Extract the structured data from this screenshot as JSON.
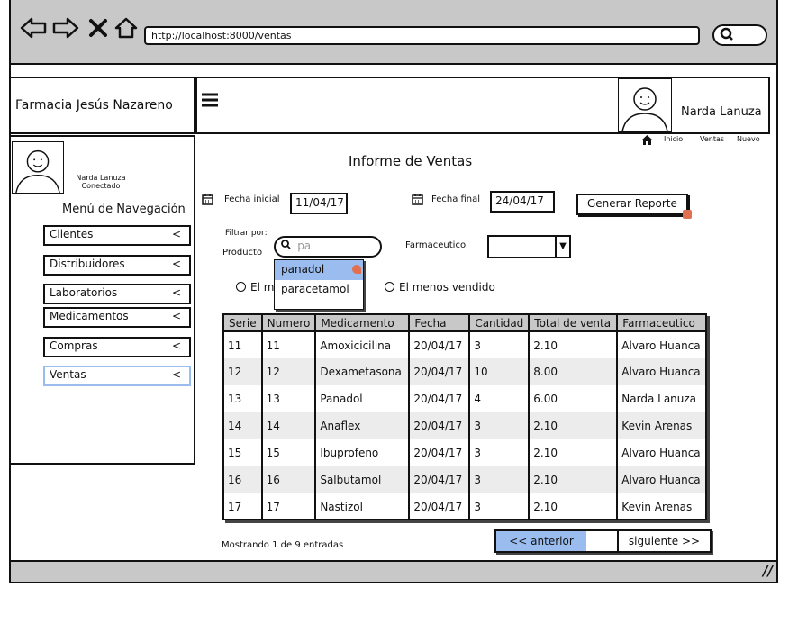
{
  "browser": {
    "back_icon": "arrow-left-icon",
    "forward_icon": "arrow-right-icon",
    "close_icon": "x-icon",
    "home_icon": "home-outline-icon",
    "url": "http://localhost:8000/ventas",
    "search_icon": "search-icon"
  },
  "header": {
    "brand": "Farmacia Jesús Nazareno",
    "menu_icon": "hamburger-icon",
    "user_name": "Narda Lanuza",
    "breadcrumb": [
      "Inicio",
      "Ventas",
      "Nuevo"
    ]
  },
  "sidebar": {
    "user_name": "Narda Lanuza",
    "status": "Conectado",
    "menu_title": "Menú de Navegación",
    "items": [
      {
        "label": "Clientes",
        "chevron": "<"
      },
      {
        "label": "Distribuidores",
        "chevron": "<"
      },
      {
        "label": "Laboratorios",
        "chevron": "<"
      },
      {
        "label": "Medicamentos",
        "chevron": "<"
      },
      {
        "label": "Compras",
        "chevron": "<"
      },
      {
        "label": "Ventas",
        "chevron": "<"
      }
    ]
  },
  "main": {
    "title": "Informe de Ventas",
    "fecha_inicial_label": "Fecha inicial",
    "fecha_inicial": "11/04/17",
    "fecha_final_label": "Fecha final",
    "fecha_final": "24/04/17",
    "generate_button": "Generar Reporte",
    "filter_label": "Filtrar por:",
    "producto_label": "Producto",
    "producto_value": "pa",
    "farmaceutico_label": "Farmaceutico",
    "farmaceutico_value": "",
    "dropdown_options": [
      "panadol",
      "paracetamol"
    ],
    "radio_most_prefix": "El m",
    "radio_least": "El menos vendido"
  },
  "table": {
    "columns": [
      "Serie",
      "Numero",
      "Medicamento",
      "Fecha",
      "Cantidad",
      "Total de venta",
      "Farmaceutico"
    ],
    "rows": [
      [
        "11",
        "11",
        "Amoxicicilina",
        "20/04/17",
        "3",
        "2.10",
        "Alvaro Huanca"
      ],
      [
        "12",
        "12",
        "Dexametasona",
        "20/04/17",
        "10",
        "8.00",
        "Alvaro Huanca"
      ],
      [
        "13",
        "13",
        "Panadol",
        "20/04/17",
        "4",
        "6.00",
        "Narda Lanuza"
      ],
      [
        "14",
        "14",
        "Anaflex",
        "20/04/17",
        "3",
        "2.10",
        "Kevin Arenas"
      ],
      [
        "15",
        "15",
        "Ibuprofeno",
        "20/04/17",
        "3",
        "2.10",
        "Alvaro Huanca"
      ],
      [
        "16",
        "16",
        "Salbutamol",
        "20/04/17",
        "3",
        "2.10",
        "Alvaro Huanca"
      ],
      [
        "17",
        "17",
        "Nastizol",
        "20/04/17",
        "3",
        "2.10",
        "Kevin Arenas"
      ]
    ]
  },
  "footer": {
    "showing": "Mostrando 1 de 9 entradas",
    "prev": "<< anterior",
    "next": "siguiente >>"
  },
  "colors": {
    "chrome_gray": "#c8c8c8",
    "selection_blue": "#9bbcef",
    "row_alt": "#ececec"
  }
}
